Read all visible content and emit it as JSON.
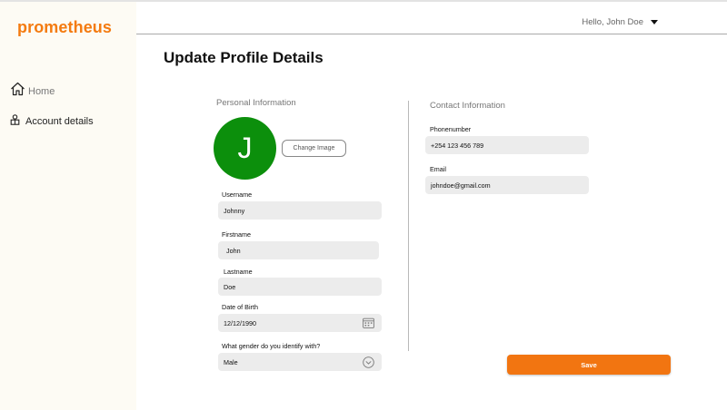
{
  "brand": {
    "name": "prometheus",
    "color": "#f47b10"
  },
  "sidebar": {
    "items": [
      {
        "label": "Home",
        "icon": "home-icon"
      },
      {
        "label": "Account details",
        "icon": "account-icon"
      }
    ]
  },
  "header": {
    "greeting": "Hello, John Doe"
  },
  "page": {
    "title": "Update Profile Details"
  },
  "personal": {
    "section_title": "Personal Information",
    "avatar_initial": "J",
    "avatar_color": "#0c8f0c",
    "change_image_label": "Change Image",
    "username": {
      "label": "Username",
      "value": "Johnny"
    },
    "firstname": {
      "label": "Firstname",
      "value": "John"
    },
    "lastname": {
      "label": "Lastname",
      "value": "Doe"
    },
    "dob": {
      "label": "Date of Birth",
      "value": "12/12/1990",
      "icon": "calendar-icon"
    },
    "gender": {
      "label": "What gender do you identify with?",
      "value": "Male",
      "icon": "chevron-down-circle-icon"
    }
  },
  "contact": {
    "section_title": "Contact Information",
    "phone": {
      "label": "Phonenumber",
      "value": "+254 123 456 789"
    },
    "email": {
      "label": "Email",
      "value": "johndoe@gmail.com"
    }
  },
  "actions": {
    "save_label": "Save",
    "save_color": "#f27511"
  }
}
